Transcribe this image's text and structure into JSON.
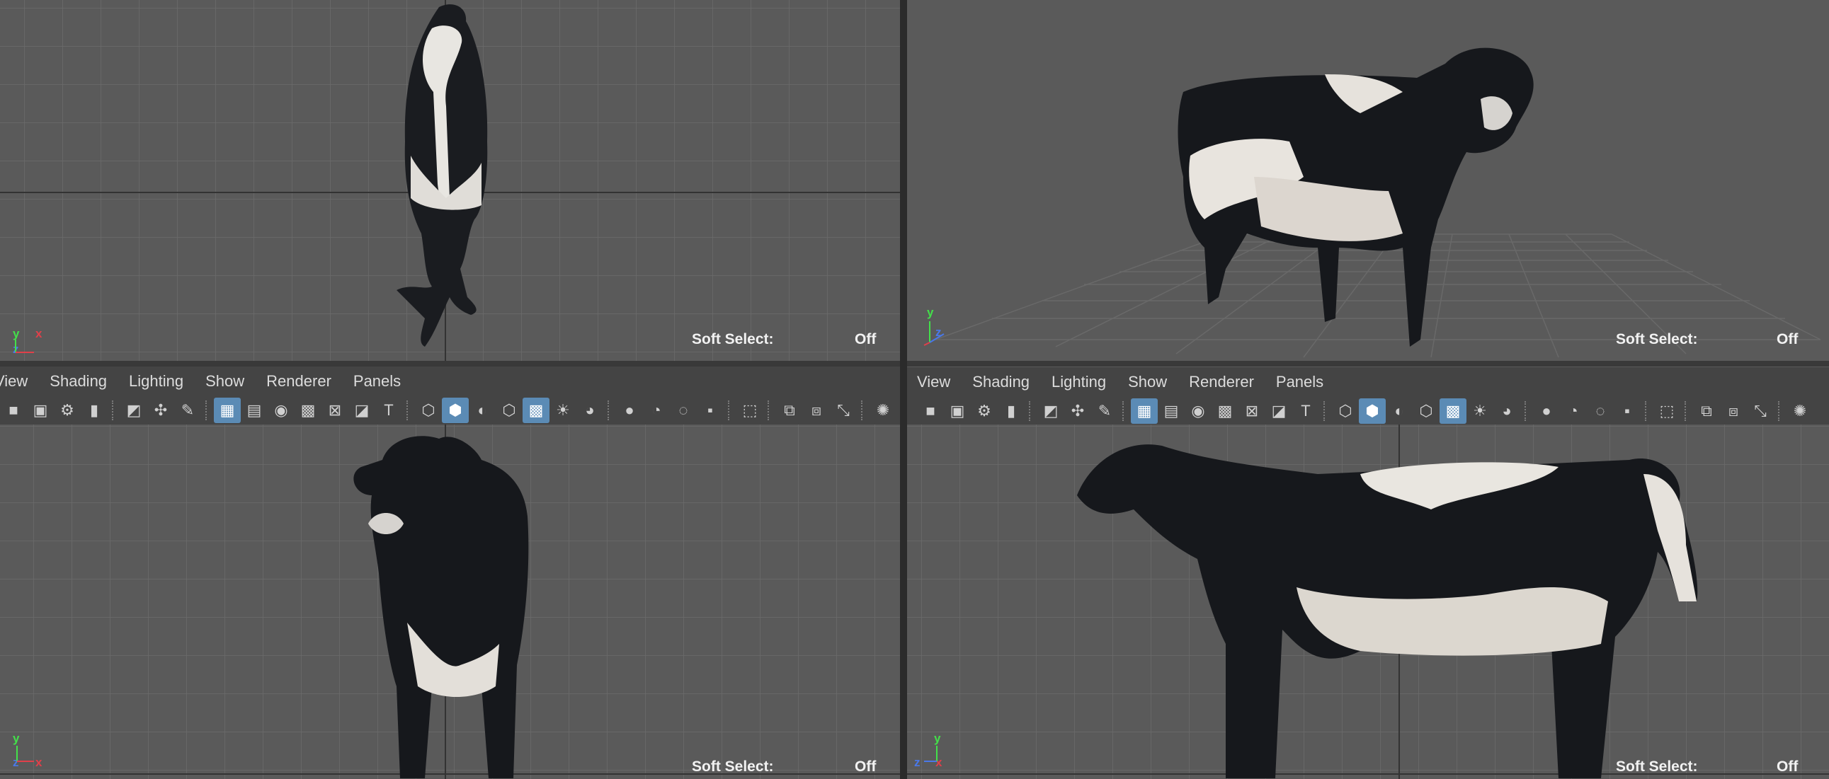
{
  "menus": [
    "View",
    "Shading",
    "Lighting",
    "Show",
    "Renderer",
    "Panels"
  ],
  "status": {
    "soft_select_label": "Soft Select:",
    "soft_select_value": "Off"
  },
  "axes": {
    "top_view": [
      "y",
      "x",
      "z"
    ],
    "persp_view": [
      "y",
      "z"
    ],
    "front_view": [
      "y",
      "z",
      "x"
    ],
    "side_view": [
      "y",
      "z",
      "x"
    ]
  },
  "toolbar_icons": [
    "camera-icon",
    "camera-lock-icon",
    "camera-attributes-icon",
    "bookmark-icon",
    "image-plane-icon",
    "2d-pan-zoom-icon",
    "grease-pencil-icon",
    "grid-icon",
    "film-gate-icon",
    "resolution-gate-icon",
    "gate-mask-icon",
    "field-chart-icon",
    "safe-action-icon",
    "safe-title-icon",
    "wireframe-icon",
    "smooth-shade-icon",
    "default-material-icon",
    "wireframe-on-shaded-icon",
    "textured-icon",
    "lights-icon",
    "shadows-icon",
    "screen-space-ao-icon",
    "motion-blur-icon",
    "anti-alias-icon",
    "depth-of-field-icon",
    "isolate-select-icon",
    "xray-icon",
    "xray-joints-icon",
    "xray-components-icon",
    "backface-cull-icon",
    "exposure-icon"
  ],
  "colors": {
    "viewport_bg": "#5a5a5a",
    "panel_bg": "#444444",
    "active_button": "#5b8bb5",
    "axis_x": "#e0404a",
    "axis_y": "#43e04a",
    "axis_z": "#4a78e8"
  }
}
